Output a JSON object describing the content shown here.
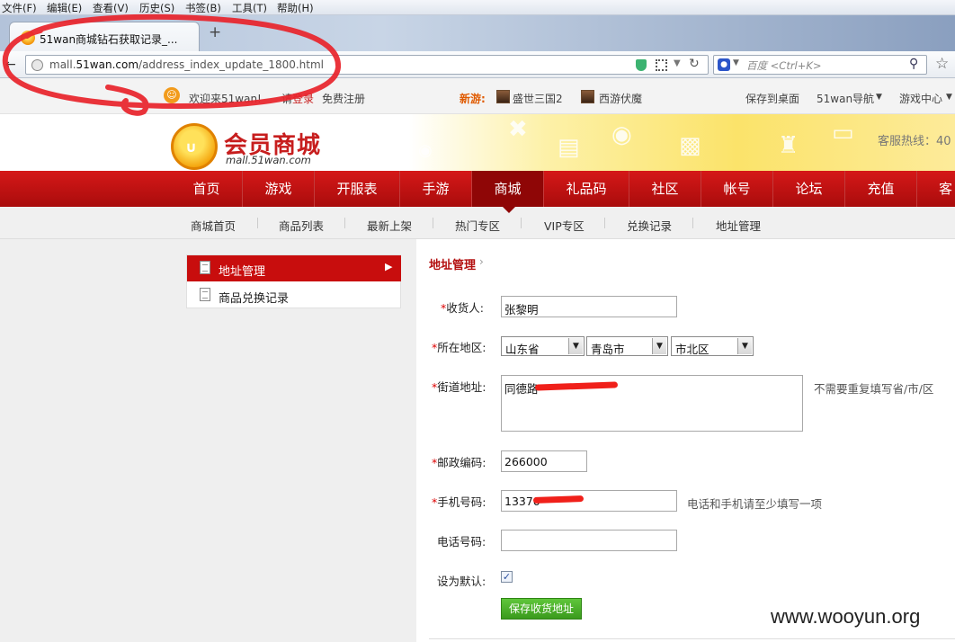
{
  "browser": {
    "menu": [
      "文件(F)",
      "编辑(E)",
      "查看(V)",
      "历史(S)",
      "书签(B)",
      "工具(T)",
      "帮助(H)"
    ],
    "tab_title": "51wan商城钻石获取记录_...",
    "new_tab": "+",
    "url_prefix": "mall.",
    "url_domain": "51wan.com",
    "url_path": "/address_index_update_1800.html",
    "search_engine_icon": "baidu-paw-icon",
    "search_placeholder": "百度 <Ctrl+K>"
  },
  "topbar": {
    "welcome": "欢迎来51wan!",
    "login_prompt": "请",
    "login": "登录",
    "register": "免费注册",
    "new_games_label": "新游:",
    "game1": "盛世三国2",
    "game2": "西游伏魔",
    "save_desktop": "保存到桌面",
    "nav_51wan": "51wan导航",
    "game_center": "游戏中心"
  },
  "header": {
    "logo_title": "会员商城",
    "logo_sub": "mall.51wan.com",
    "hotline": "客服热线：40"
  },
  "main_nav": [
    "首页",
    "游戏",
    "开服表",
    "手游",
    "商城",
    "礼品码",
    "社区",
    "帐号",
    "论坛",
    "充值",
    "客"
  ],
  "main_nav_active": "商城",
  "sub_nav": [
    "商城首页",
    "商品列表",
    "最新上架",
    "热门专区",
    "VIP专区",
    "兑换记录",
    "地址管理"
  ],
  "side_menu": {
    "item1": "地址管理",
    "item2": "商品兑换记录"
  },
  "breadcrumb": "地址管理",
  "form": {
    "receiver_label": "收货人:",
    "receiver_value": "张黎明",
    "region_label": "所在地区:",
    "province": "山东省",
    "city": "青岛市",
    "district": "市北区",
    "street_label": "街道地址:",
    "street_value": "同德路",
    "street_hint": "不需要重复填写省/市/区",
    "zip_label": "邮政编码:",
    "zip_value": "266000",
    "mobile_label": "手机号码:",
    "mobile_value": "13370",
    "mobile_hint": "电话和手机请至少填写一项",
    "phone_label": "电话号码:",
    "phone_value": "",
    "default_label": "设为默认:",
    "default_checked": true,
    "save_button": "保存收货地址",
    "required_mark": "*"
  },
  "watermark": "www.wooyun.org",
  "colors": {
    "nav_red": "#c80d0d",
    "annotation_red": "#e8232a",
    "save_green": "#4cae2c"
  }
}
